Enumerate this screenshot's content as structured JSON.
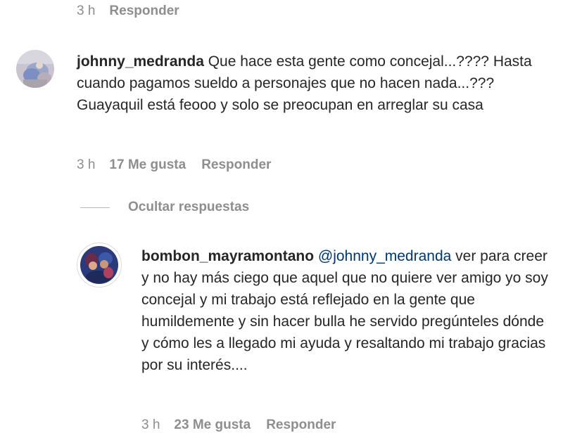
{
  "top_meta": {
    "time": "3 h",
    "reply_label": "Responder"
  },
  "comment1": {
    "username": "johnny_medranda",
    "text": "Que hace esta gente como concejal...???? Hasta cuando pagamos sueldo a personajes que no hacen nada...??? Guayaquil está feooo y solo se preocupan en arreglar su casa",
    "time": "3 h",
    "likes": "17 Me gusta",
    "reply_label": "Responder"
  },
  "replies_toggle": {
    "label": "Ocultar respuestas"
  },
  "reply1": {
    "username": "bombon_mayramontano",
    "mention": "@johnny_medranda",
    "text": "ver para creer y no hay más ciego que aquel que no quiere ver amigo yo soy concejal y mi trabajo está reflejado en la gente que humildemente y sin hacer bulla he servido pregúnteles dónde y cómo les a llegado mi ayuda y resaltando mi trabajo gracias por su interés....",
    "time": "3 h",
    "likes": "23 Me gusta",
    "reply_label": "Responder"
  },
  "colors": {
    "text": "#262626",
    "secondary": "#8e8e8e",
    "mention": "#00376b"
  }
}
